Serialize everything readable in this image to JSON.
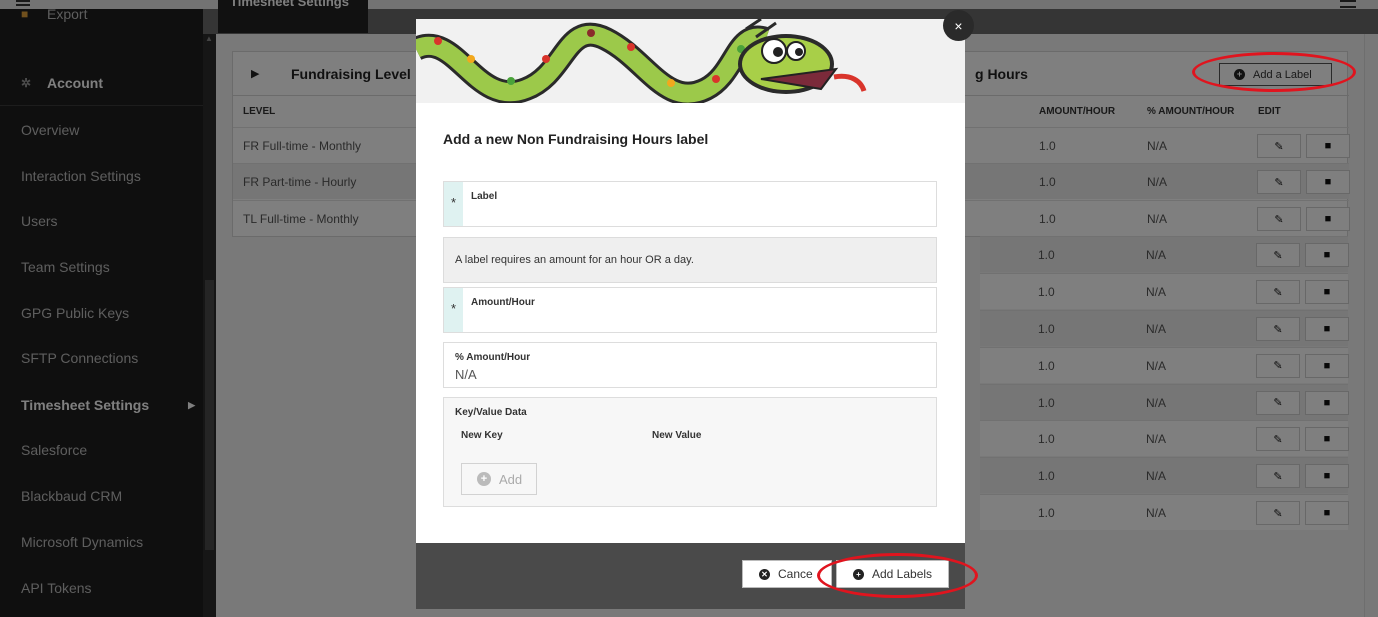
{
  "topbar": {
    "tab_label": "Timesheet Settings"
  },
  "sidebar": {
    "items": [
      {
        "label": "Export",
        "icon": "truck-icon"
      },
      {
        "label": "Account",
        "icon": "gear-icon"
      },
      {
        "label": "Overview"
      },
      {
        "label": "Interaction Settings"
      },
      {
        "label": "Users"
      },
      {
        "label": "Team Settings"
      },
      {
        "label": "GPG Public Keys"
      },
      {
        "label": "SFTP Connections"
      },
      {
        "label": "Timesheet Settings"
      },
      {
        "label": "Salesforce"
      },
      {
        "label": "Blackbaud CRM"
      },
      {
        "label": "Microsoft Dynamics"
      },
      {
        "label": "API Tokens"
      }
    ]
  },
  "panel": {
    "title_left": "Fundraising Level",
    "title_right": "g Hours",
    "add_label_button": "Add a Label",
    "left_header": "LEVEL",
    "left_rows": [
      "FR Full-time - Monthly",
      "FR Part-time - Hourly",
      "TL Full-time - Monthly"
    ],
    "right_headers": {
      "amount_hour": "AMOUNT/HOUR",
      "pct_amount_hour": "% AMOUNT/HOUR",
      "edit": "EDIT"
    },
    "right_rows": [
      {
        "amount": "1.0",
        "pct": "N/A"
      },
      {
        "amount": "1.0",
        "pct": "N/A"
      },
      {
        "amount": "1.0",
        "pct": "N/A"
      },
      {
        "amount": "1.0",
        "pct": "N/A"
      },
      {
        "amount": "1.0",
        "pct": "N/A"
      },
      {
        "amount": "1.0",
        "pct": "N/A"
      },
      {
        "amount": "1.0",
        "pct": "N/A"
      },
      {
        "amount": "1.0",
        "pct": "N/A"
      },
      {
        "amount": "1.0",
        "pct": "N/A"
      },
      {
        "amount": "1.0",
        "pct": "N/A"
      },
      {
        "amount": "1.0",
        "pct": "N/A"
      }
    ]
  },
  "modal": {
    "close_label": "×",
    "title": "Add a new Non Fundraising Hours label",
    "required_marker": "*",
    "label_field": {
      "label": "Label",
      "value": ""
    },
    "info_text": "A label requires an amount for an hour OR a day.",
    "amount_field": {
      "label": "Amount/Hour",
      "value": ""
    },
    "pct_field": {
      "label": "% Amount/Hour",
      "value": "N/A"
    },
    "kv": {
      "title": "Key/Value Data",
      "key_header": "New Key",
      "value_header": "New Value",
      "add_button": "Add"
    },
    "cancel_button": "Cance",
    "add_labels_button": "Add Labels"
  },
  "colors": {
    "sidebar_bg": "#1f1f1f",
    "footer_bg": "#4a4a4a",
    "required_bg": "#dff2f1",
    "annotation": "#e0141e"
  }
}
